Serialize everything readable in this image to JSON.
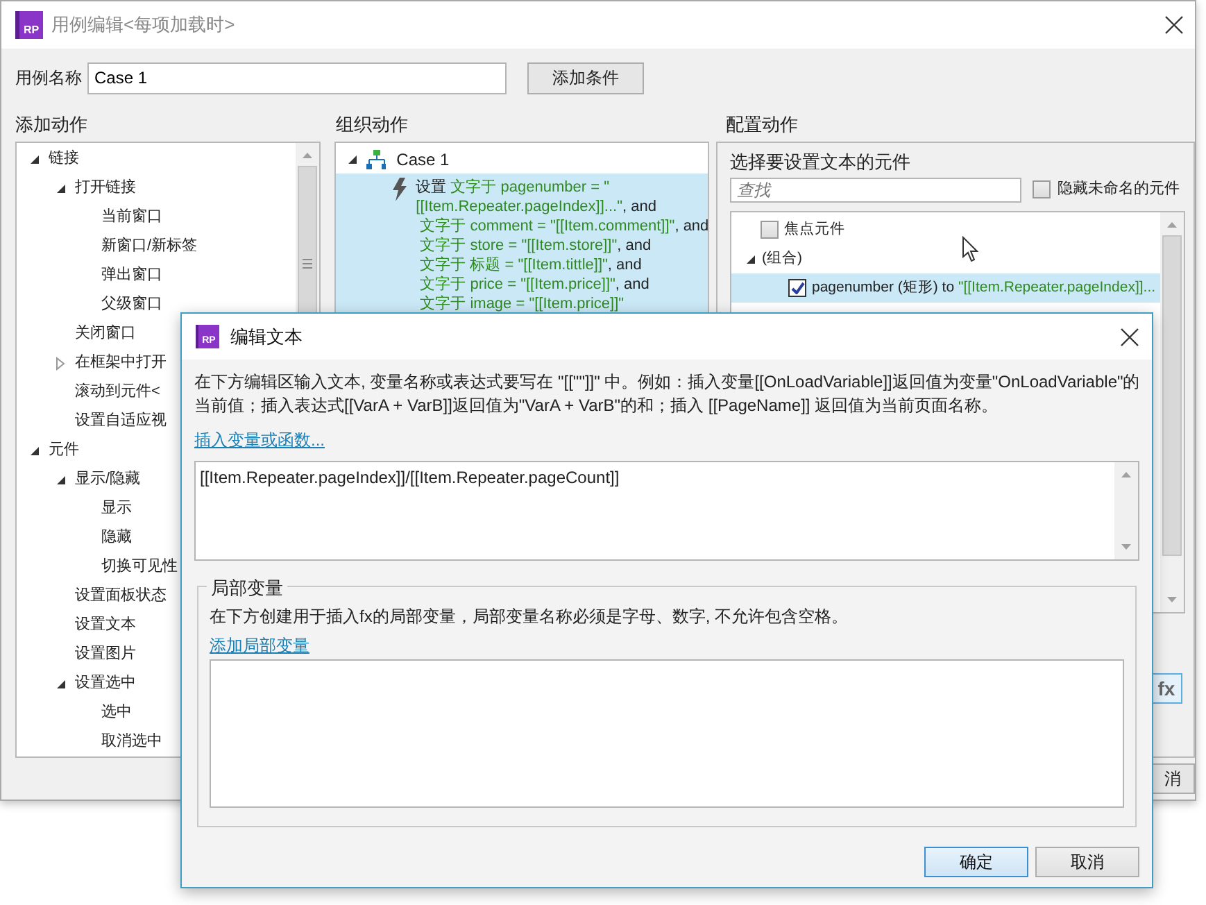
{
  "window": {
    "logo_text": "RP",
    "title": "用例编辑<每项加载时>"
  },
  "case_name": {
    "label": "用例名称",
    "value": "Case 1"
  },
  "add_condition_button": "添加条件",
  "add_actions": {
    "heading": "添加动作",
    "tree": [
      {
        "label": "链接",
        "expanded": true,
        "children": [
          {
            "label": "打开链接",
            "expanded": true,
            "children": [
              {
                "label": "当前窗口"
              },
              {
                "label": "新窗口/新标签"
              },
              {
                "label": "弹出窗口"
              },
              {
                "label": "父级窗口"
              }
            ]
          },
          {
            "label": "关闭窗口"
          },
          {
            "label": "在框架中打开",
            "expanded": false
          },
          {
            "label": "滚动到元件<"
          },
          {
            "label": "设置自适应视"
          }
        ]
      },
      {
        "label": "元件",
        "expanded": true,
        "children": [
          {
            "label": "显示/隐藏",
            "expanded": true,
            "children": [
              {
                "label": "显示"
              },
              {
                "label": "隐藏"
              },
              {
                "label": "切换可见性"
              }
            ]
          },
          {
            "label": "设置面板状态"
          },
          {
            "label": "设置文本"
          },
          {
            "label": "设置图片"
          },
          {
            "label": "设置选中",
            "expanded": true,
            "children": [
              {
                "label": "选中"
              },
              {
                "label": "取消选中"
              }
            ]
          }
        ]
      }
    ]
  },
  "organize_actions": {
    "heading": "组织动作",
    "cases": [
      {
        "label": "Case 1",
        "expanded": true,
        "selected": false,
        "actions": [
          {
            "verb": "设置",
            "selected": true,
            "details": [
              {
                "text": "文字于 pagenumber = \"[[Item.Repeater.pageIndex]]...\"",
                "suffix": ", and"
              },
              {
                "text": "文字于 comment = \"[[Item.comment]]\"",
                "suffix": ", and"
              },
              {
                "text": "文字于 store = \"[[Item.store]]\"",
                "suffix": ", and"
              },
              {
                "text": "文字于 标题 = \"[[Item.tittle]]\"",
                "suffix": ", and"
              },
              {
                "text": "文字于 price = \"[[Item.price]]\"",
                "suffix": ", and"
              },
              {
                "text": "文字于 image = \"[[Item.price]]\""
              }
            ]
          }
        ]
      }
    ]
  },
  "configure_action": {
    "heading": "配置动作",
    "prompt": "选择要设置文本的元件",
    "search": {
      "placeholder": "查找"
    },
    "hide_unnamed": {
      "label": "隐藏未命名的元件",
      "checked": false
    },
    "widgets": [
      {
        "label": "焦点元件",
        "checked": false,
        "selected": false
      },
      {
        "label": "(组合)",
        "expanded": true,
        "children": [
          {
            "label": "pagenumber (矩形) to ",
            "value": "\"[[Item.Repeater.pageIndex]]...",
            "checked": true,
            "selected": true
          }
        ]
      }
    ],
    "fx_button": "fx"
  },
  "back_cancel_button": "消",
  "dialog": {
    "logo_text": "RP",
    "title": "编辑文本",
    "instructions": "在下方编辑区输入文本, 变量名称或表达式要写在 \"[[\"\"]]\" 中。例如：插入变量[[OnLoadVariable]]返回值为变量\"OnLoadVariable\"的当前值；插入表达式[[VarA + VarB]]返回值为\"VarA + VarB\"的和；插入 [[PageName]] 返回值为当前页面名称。",
    "insert_link": "插入变量或函数...",
    "text_value": "[[Item.Repeater.pageIndex]]/[[Item.Repeater.pageCount]]",
    "local_variables": {
      "legend": "局部变量",
      "description": "在下方创建用于插入fx的局部变量，局部变量名称必须是字母、数字, 不允许包含空格。",
      "add_link": "添加局部变量"
    },
    "buttons": [
      {
        "label": "确定",
        "default": true
      },
      {
        "label": "取消",
        "default": false
      }
    ]
  }
}
